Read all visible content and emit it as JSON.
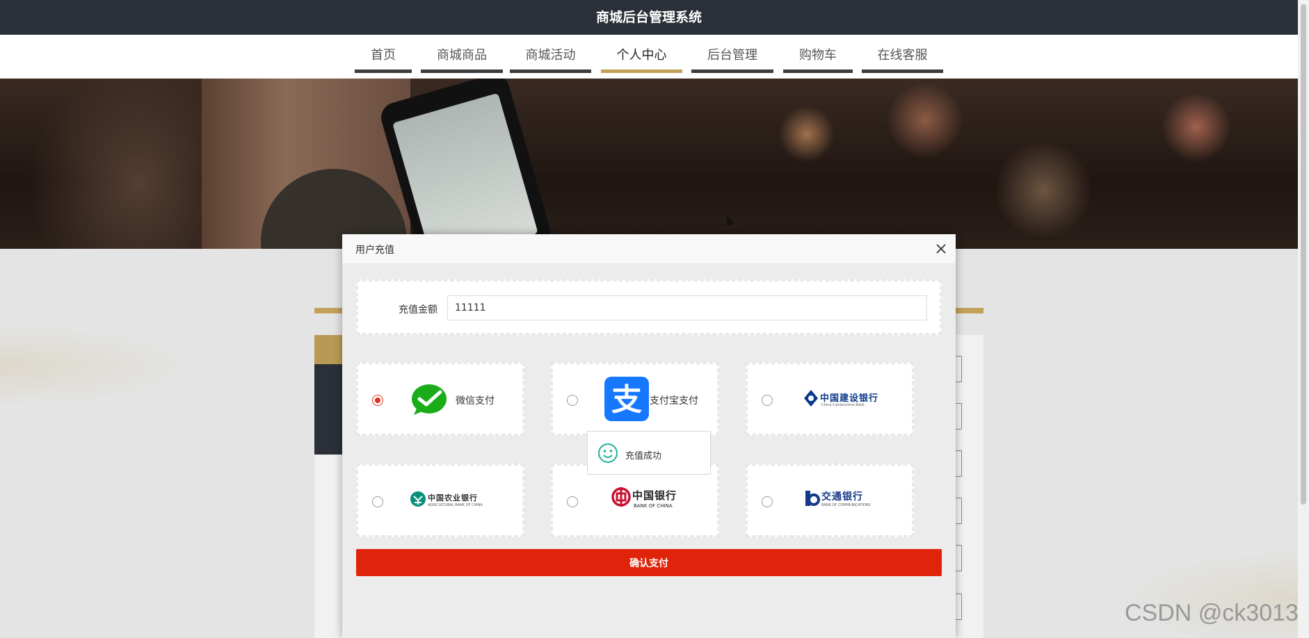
{
  "app": {
    "title": "商城后台管理系统"
  },
  "nav": {
    "items": [
      {
        "label": "首页",
        "active": false
      },
      {
        "label": "商城商品",
        "active": false
      },
      {
        "label": "商城活动",
        "active": false
      },
      {
        "label": "个人中心",
        "active": true
      },
      {
        "label": "后台管理",
        "active": false
      },
      {
        "label": "购物车",
        "active": false
      },
      {
        "label": "在线客服",
        "active": false
      }
    ]
  },
  "modal": {
    "title": "用户充值",
    "close_icon": "close-icon",
    "amount": {
      "label": "充值金额",
      "value": "11111"
    },
    "payment_options": [
      {
        "id": "wechat",
        "label": "微信支付",
        "icon": "wechat-pay-icon",
        "selected": true
      },
      {
        "id": "alipay",
        "label": "支付宝支付",
        "icon": "alipay-icon",
        "selected": false
      },
      {
        "id": "ccb",
        "label": "中国建设银行",
        "sub": "China Construction Bank",
        "icon": "ccb-logo",
        "selected": false
      },
      {
        "id": "abc",
        "label": "中国农业银行",
        "sub": "AGRICULTURAL BANK OF CHINA",
        "icon": "abc-logo",
        "selected": false
      },
      {
        "id": "boc",
        "label": "中国银行",
        "sub": "BANK OF CHINA",
        "icon": "boc-logo",
        "selected": false
      },
      {
        "id": "bocom",
        "label": "交通银行",
        "sub": "BANK OF COMMUNICATIONS",
        "icon": "bocom-logo",
        "selected": false
      }
    ],
    "confirm_label": "确认支付"
  },
  "toast": {
    "text": "充值成功",
    "icon": "smile-icon"
  },
  "watermark": "CSDN @ck3013",
  "colors": {
    "accent": "#c2a15a",
    "dark": "#2b3038",
    "primary_button": "#e0230b",
    "wechat": "#1aad19",
    "alipay": "#1677ff"
  }
}
